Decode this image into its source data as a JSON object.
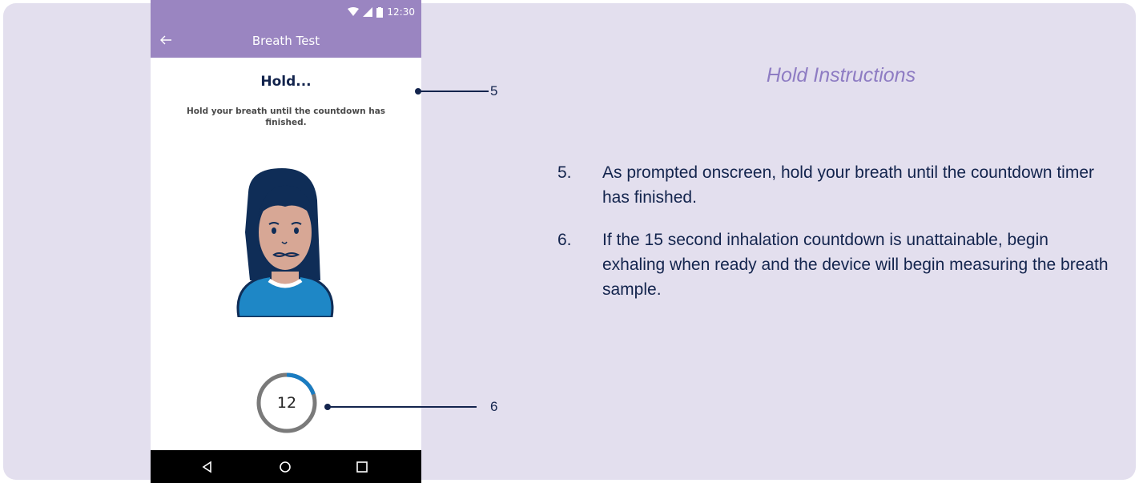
{
  "status_bar": {
    "time": "12:30",
    "icons": [
      "wifi-icon",
      "signal-icon",
      "battery-icon"
    ]
  },
  "app_bar": {
    "title": "Breath Test",
    "back_icon": "back-arrow-icon"
  },
  "screen": {
    "title": "Hold...",
    "body": "Hold your breath until the countdown has finished."
  },
  "timer": {
    "value": "12",
    "progress": 0.2,
    "accent": "#1a7cc1"
  },
  "nav_bar": {
    "icons": [
      "back-triangle-icon",
      "home-circle-icon",
      "recents-square-icon"
    ]
  },
  "callouts": [
    {
      "label": "5"
    },
    {
      "label": "6"
    }
  ],
  "instructions": {
    "title": "Hold Instructions",
    "items": [
      {
        "num": "5.",
        "text": "As prompted onscreen, hold your breath until the countdown timer has finished."
      },
      {
        "num": "6.",
        "text": "If the 15 second inhalation countdown is unattainable, begin exhaling when ready and the device will begin measuring the breath sample."
      }
    ]
  },
  "colors": {
    "panel": "#e3dfee",
    "app_bar": "#9a85c1",
    "navy": "#13244d",
    "heading": "#8e7cc3"
  }
}
